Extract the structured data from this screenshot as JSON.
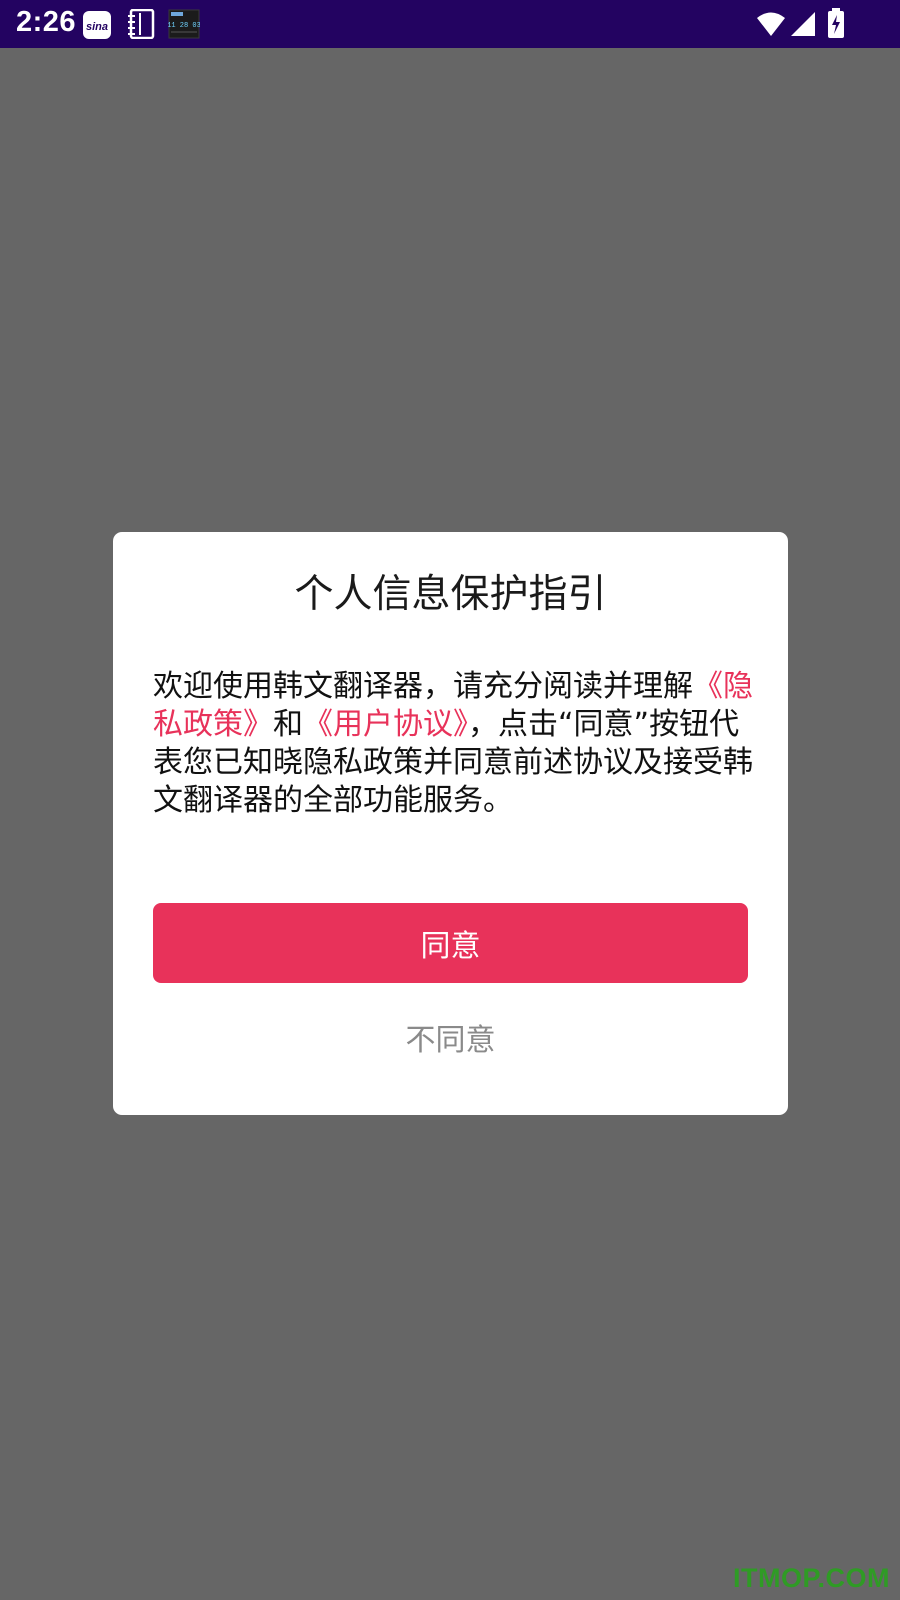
{
  "status_bar": {
    "time": "2:26",
    "left_icons": [
      "sina-app-icon",
      "notebook-icon",
      "clock-widget-icon"
    ],
    "right_icons": [
      "wifi-icon",
      "cell-signal-icon",
      "battery-charging-icon"
    ],
    "sina_label": "sina",
    "clock_widget_text": "11 28 03"
  },
  "dialog": {
    "title": "个人信息保护指引",
    "body": {
      "intro": "欢迎使用韩文翻译器，请充分阅读并理解",
      "privacy_link": "《隐私政策》",
      "and": "和",
      "user_agreement_link": "《用户协议》",
      "outro": "，点击“同意”按钮代表您已知晓隐私政策并同意前述协议及接受韩文翻译器的全部功能服务。"
    },
    "agree_label": "同意",
    "disagree_label": "不同意"
  },
  "watermark": "ITMOP.COM",
  "colors": {
    "status_bar_bg": "#230361",
    "overlay_bg": "#666666",
    "accent": "#e8325a",
    "secondary_text": "#8a8a8a",
    "watermark": "#2f9b25"
  }
}
